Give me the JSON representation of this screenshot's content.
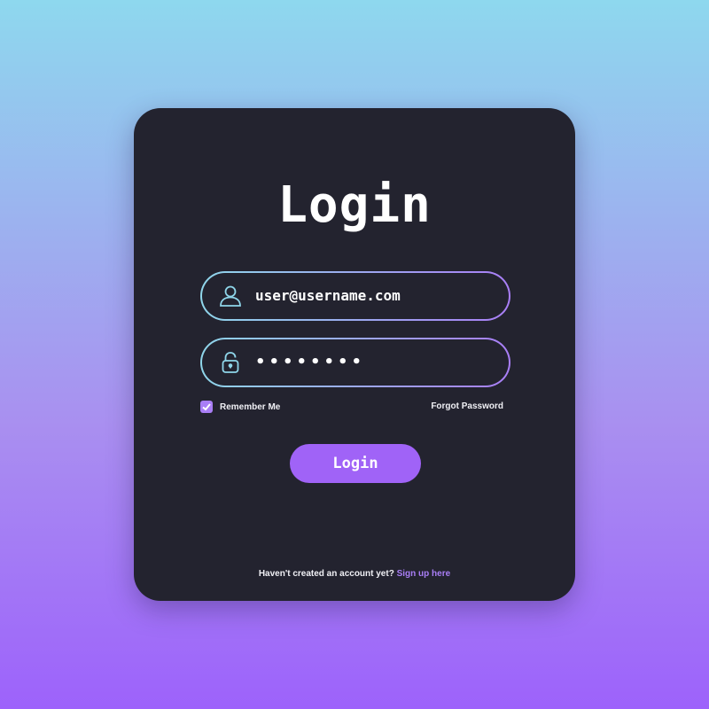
{
  "login_card": {
    "title": "Login",
    "username": {
      "value": "user@username.com",
      "icon": "user-icon"
    },
    "password": {
      "value": "••••••••",
      "icon": "lock-icon"
    },
    "remember_me": {
      "label": "Remember Me",
      "checked": true
    },
    "forgot_password": "Forgot Password",
    "login_button": "Login",
    "footer": {
      "text": "Haven't created an account yet?",
      "link": "Sign up here"
    }
  },
  "colors": {
    "card_background": "#23232f",
    "accent_purple": "#a063f7",
    "accent_cyan": "#8fd6ea",
    "link_purple": "#a97ef6"
  }
}
